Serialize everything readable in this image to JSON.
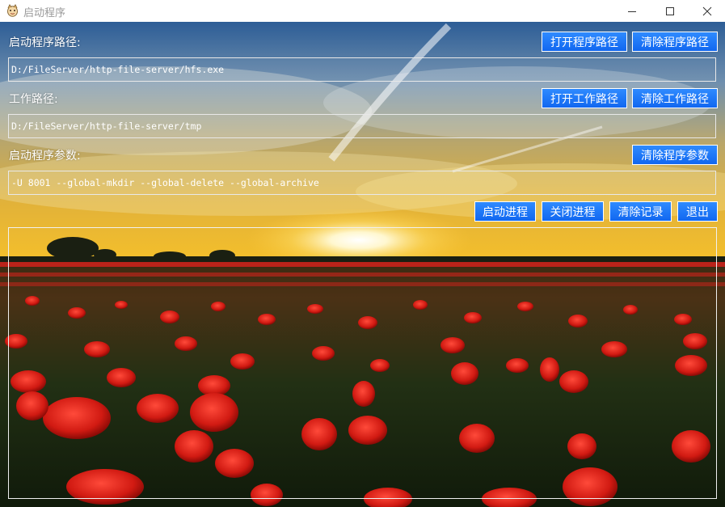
{
  "window": {
    "title": "启动程序",
    "controls": [
      "minimize-icon",
      "maximize-icon",
      "close-icon"
    ]
  },
  "program_path": {
    "label": "启动程序路径:",
    "value": "D:/FileServer/http-file-server/hfs.exe",
    "open_button": "打开程序路径",
    "clear_button": "清除程序路径"
  },
  "work_path": {
    "label": "工作路径:",
    "value": "D:/FileServer/http-file-server/tmp",
    "open_button": "打开工作路径",
    "clear_button": "清除工作路径"
  },
  "params": {
    "label": "启动程序参数:",
    "value": "-U 8001 --global-mkdir --global-delete --global-archive",
    "clear_button": "清除程序参数"
  },
  "actions": {
    "start": "启动进程",
    "stop": "关闭进程",
    "clear_log": "清除记录",
    "exit": "退出"
  },
  "log": {
    "text": ""
  },
  "colors": {
    "button": "#1a73f5",
    "button_border": "#ffffff",
    "text": "#ffffff",
    "title_text": "#9a9a9a"
  }
}
